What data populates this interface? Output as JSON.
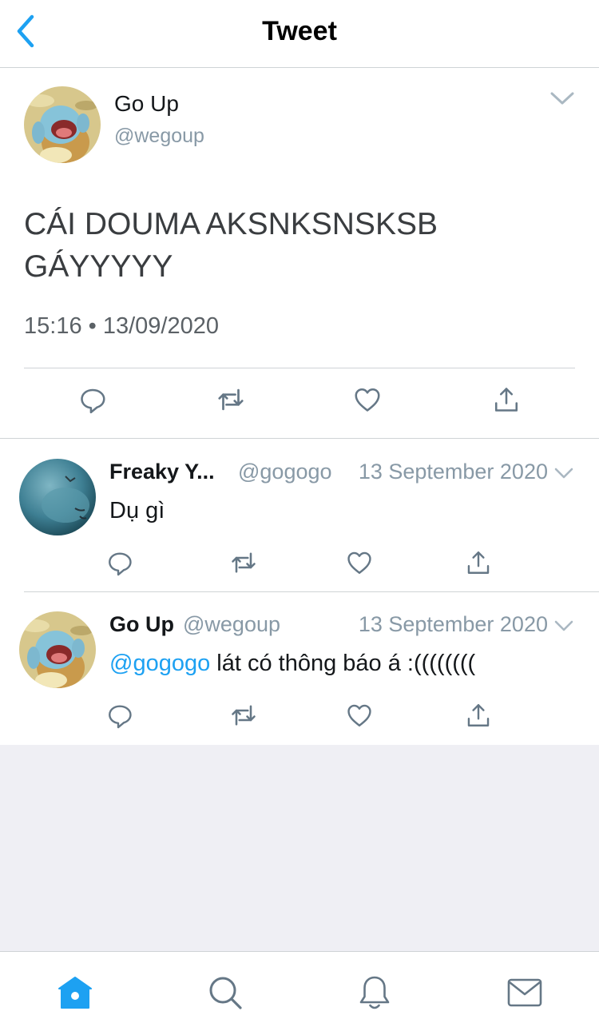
{
  "nav": {
    "title": "Tweet"
  },
  "tweet": {
    "name": "Go Up",
    "handle": "@wegoup",
    "text_line1": "CÁI DOUMA AKSNKSNSKSB",
    "text_line2": "GÁYYYYY",
    "timestamp": "15:16 • 13/09/2020"
  },
  "replies": [
    {
      "name": "Freaky Y...",
      "handle": "@gogogo",
      "date": "13 September 2020",
      "text": "Dụ gì"
    },
    {
      "name": "Go Up",
      "handle": "@wegoup",
      "date": "13 September 2020",
      "mention": "@gogogo",
      "text": " lát có thông báo á :(((((((("
    }
  ],
  "colors": {
    "accent": "#1da1f2",
    "icon_gray": "#657786",
    "secondary_text": "#8899a6",
    "background_gray": "#efeff4"
  },
  "icons": {
    "back": "chevron-left-icon",
    "menu": "chevron-down-icon",
    "reply": "reply-icon",
    "retweet": "retweet-icon",
    "like": "heart-icon",
    "share": "share-icon",
    "home": "home-icon",
    "search": "search-icon",
    "notifications": "bell-icon",
    "messages": "mail-icon"
  }
}
